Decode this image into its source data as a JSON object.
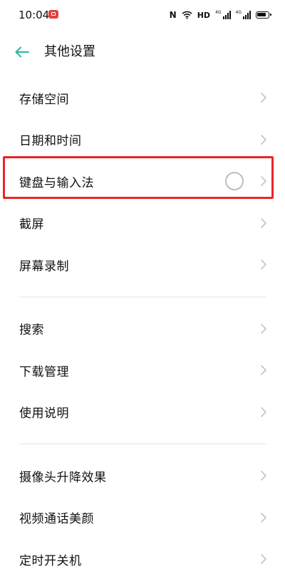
{
  "status_bar": {
    "time": "10:04",
    "nfc_label": "N",
    "hd_label": "HD",
    "signal_tags": [
      "4G",
      "4G"
    ]
  },
  "header": {
    "title": "其他设置"
  },
  "groups": [
    {
      "items": [
        {
          "label": "存储空间"
        },
        {
          "label": "日期和时间"
        },
        {
          "label": "键盘与输入法"
        },
        {
          "label": "截屏"
        },
        {
          "label": "屏幕录制"
        }
      ]
    },
    {
      "items": [
        {
          "label": "搜索"
        },
        {
          "label": "下载管理"
        },
        {
          "label": "使用说明"
        }
      ]
    },
    {
      "items": [
        {
          "label": "摄像头升降效果"
        },
        {
          "label": "视频通话美颜"
        },
        {
          "label": "定时开关机"
        }
      ]
    }
  ],
  "colors": {
    "accent": "#2bb89a",
    "highlight": "#e8262a",
    "chevron": "#c4c4c4",
    "divider": "#e6e6e6"
  }
}
